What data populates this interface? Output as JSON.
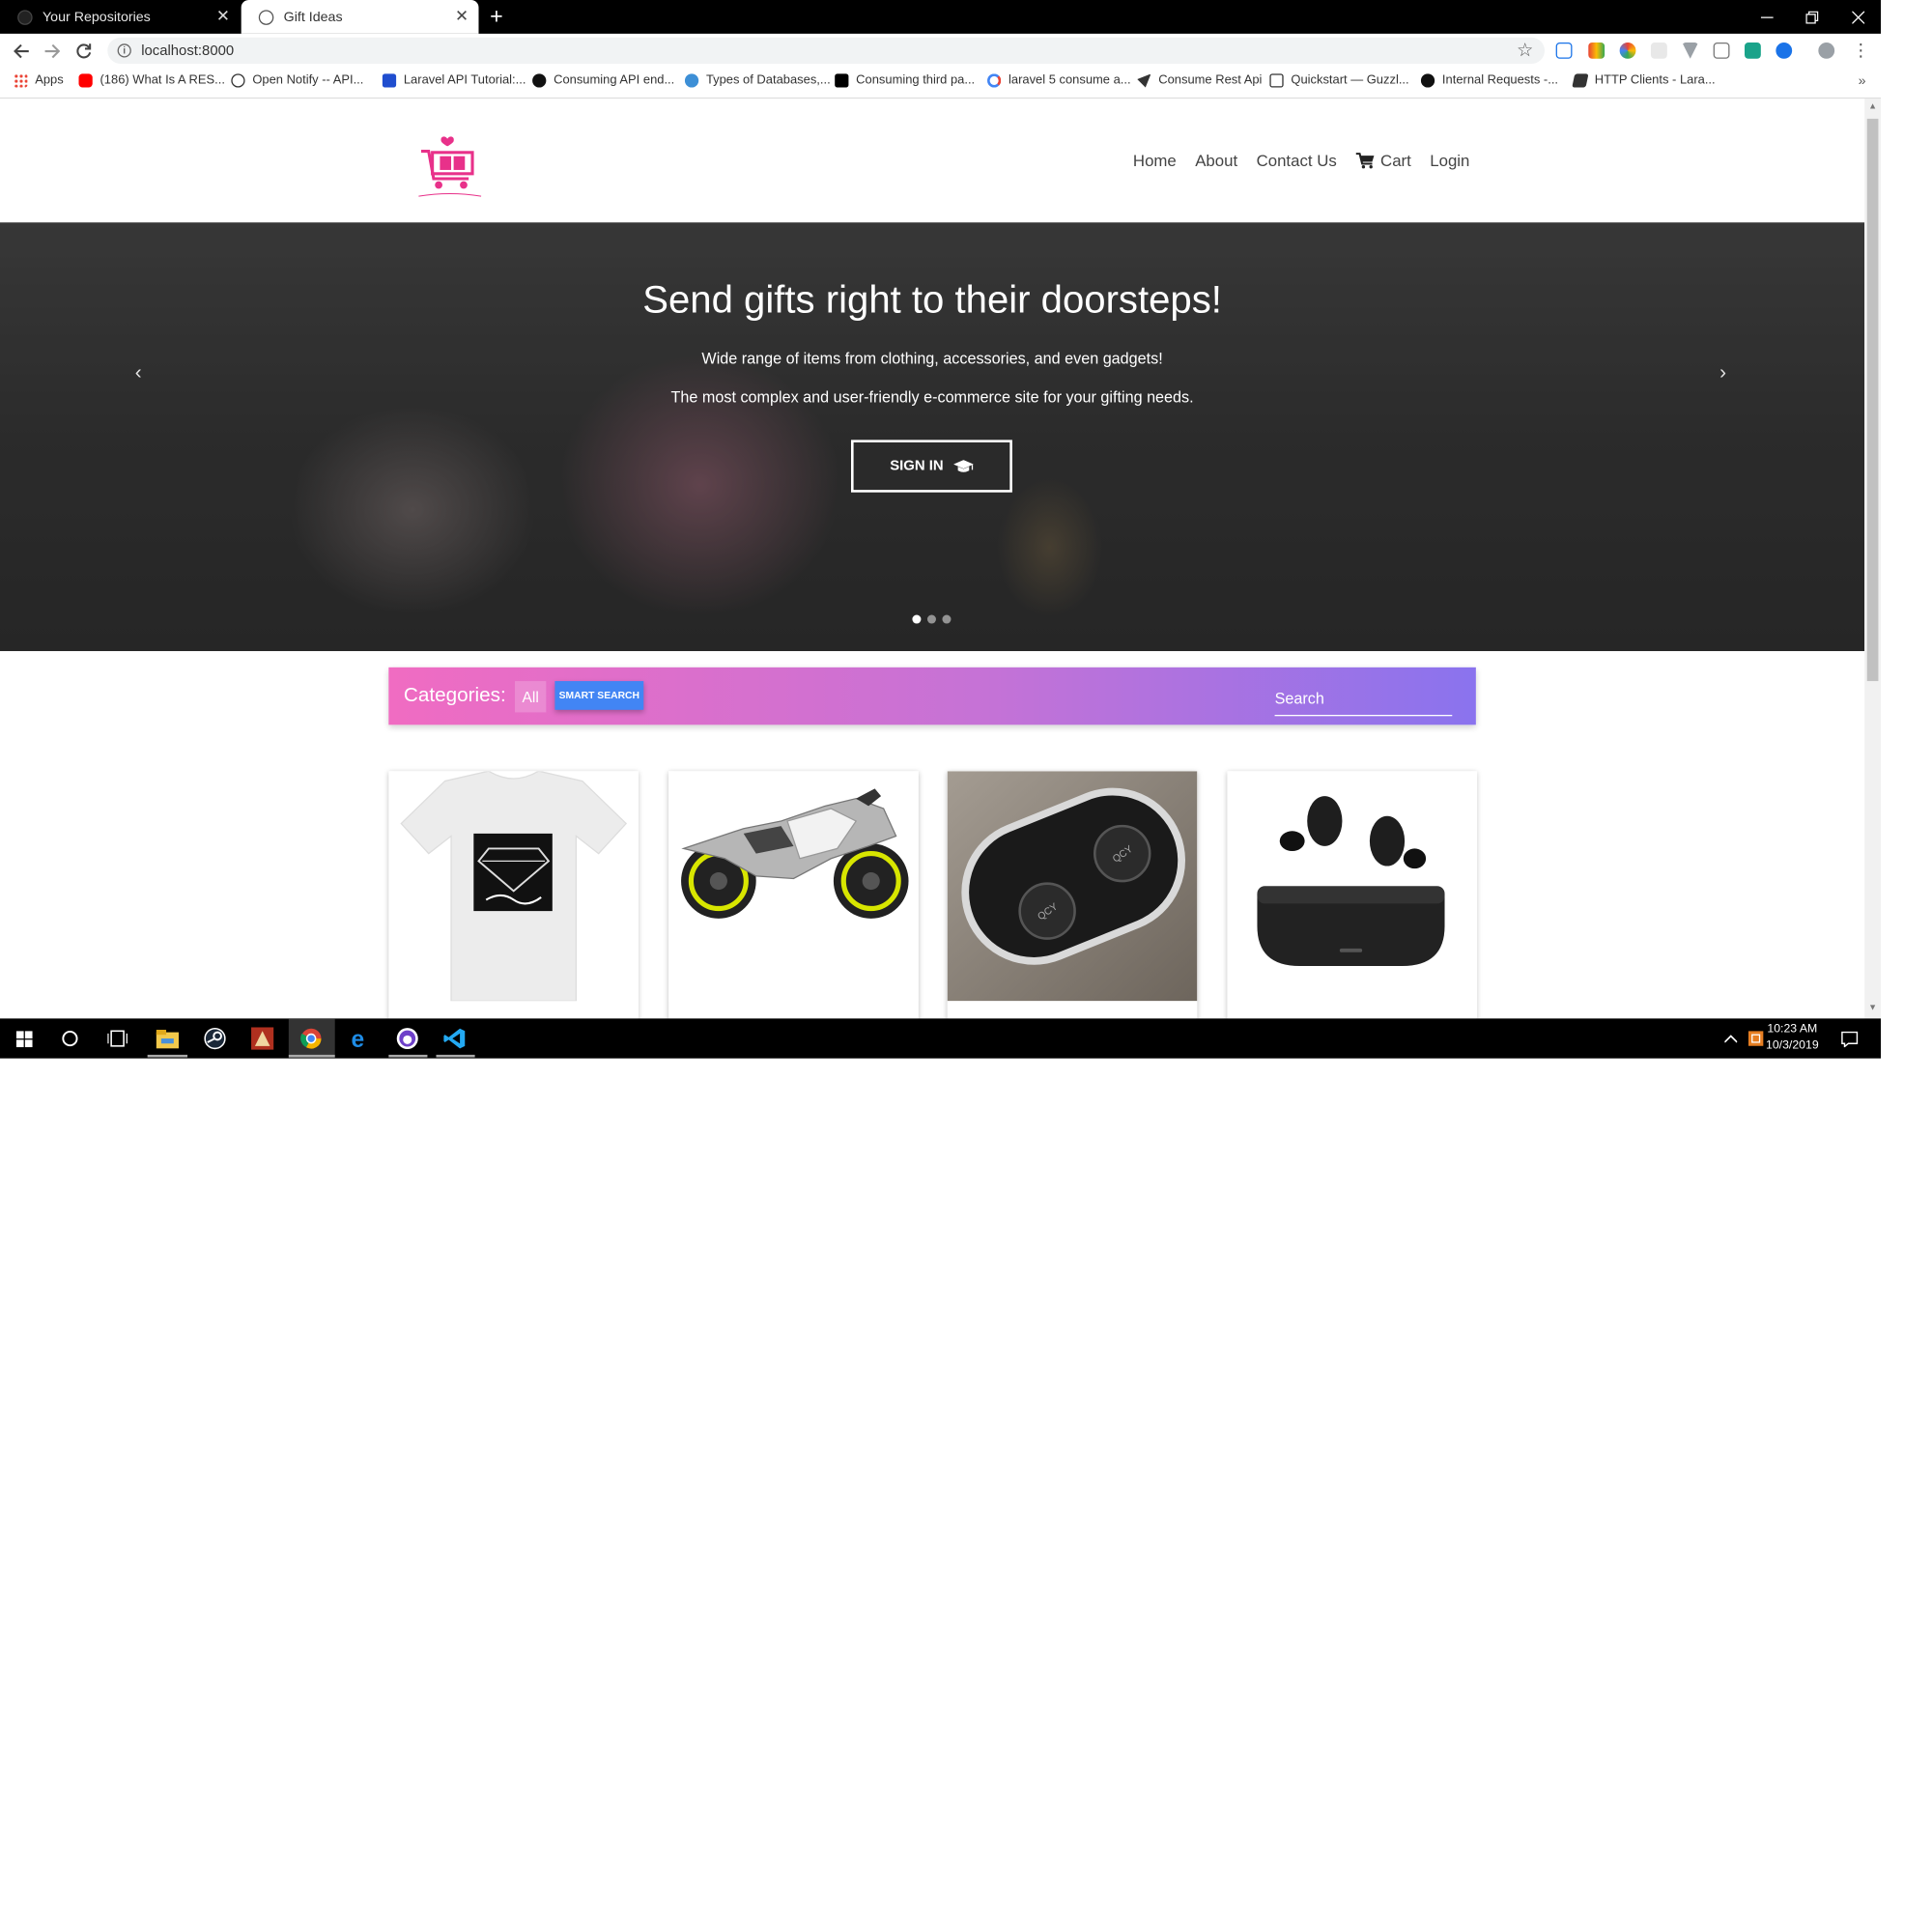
{
  "browser": {
    "tabs": [
      {
        "title": "Your Repositories",
        "active": false
      },
      {
        "title": "Gift Ideas",
        "active": true
      }
    ],
    "new_tab": "+",
    "url": "localhost:8000",
    "bookmarks": [
      {
        "label": "Apps",
        "icon": "apps-grid-icon",
        "color": "#e94235"
      },
      {
        "label": "(186) What Is A RES...",
        "icon": "youtube-icon",
        "color": "#ff0000"
      },
      {
        "label": "Open Notify -- API...",
        "icon": "globe-icon",
        "color": "#333333"
      },
      {
        "label": "Laravel API Tutorial:...",
        "icon": "toptal-icon",
        "color": "#204ecf"
      },
      {
        "label": "Consuming API end...",
        "icon": "github-icon",
        "color": "#111111"
      },
      {
        "label": "Types of Databases,...",
        "icon": "circle-icon",
        "color": "#3d8fd6"
      },
      {
        "label": "Consuming third pa...",
        "icon": "medium-icon",
        "color": "#000000"
      },
      {
        "label": "laravel 5 consume a...",
        "icon": "google-icon",
        "color": "#4285f4"
      },
      {
        "label": "Consume Rest Api",
        "icon": "paper-plane-icon",
        "color": "#333333"
      },
      {
        "label": "Quickstart — Guzzl...",
        "icon": "document-icon",
        "color": "#333333"
      },
      {
        "label": "Internal Requests -...",
        "icon": "github-icon",
        "color": "#111111"
      },
      {
        "label": "HTTP Clients - Lara...",
        "icon": "book-icon",
        "color": "#333333"
      }
    ],
    "bookmarks_more": "»"
  },
  "site": {
    "logo_icon": "gift-cart-logo-icon",
    "brand_color": "#e8318a",
    "nav": {
      "home": "Home",
      "about": "About",
      "contact": "Contact Us",
      "cart": "Cart",
      "login": "Login"
    },
    "hero": {
      "title": "Send gifts right to their doorsteps!",
      "line1": "Wide range of items from clothing, accessories, and even gadgets!",
      "line2": "The most complex and user-friendly e-commerce site for your gifting needs.",
      "cta": "SIGN IN",
      "slide_count": 3,
      "active_slide": 1
    },
    "categories": {
      "label": "Categories:",
      "all": "All",
      "smart_search": "SMART SEARCH",
      "search_placeholder": "Search",
      "gradient_start": "#f06cc2",
      "gradient_end": "#8a73ee"
    },
    "products": [
      {
        "image": "white-tshirt-diamond-print"
      },
      {
        "image": "sport-motorcycle-yellow-wheels"
      },
      {
        "image": "earbuds-in-charging-case"
      },
      {
        "image": "earbuds-above-charging-case"
      }
    ]
  },
  "taskbar": {
    "time": "10:23 AM",
    "date": "10/3/2019"
  }
}
